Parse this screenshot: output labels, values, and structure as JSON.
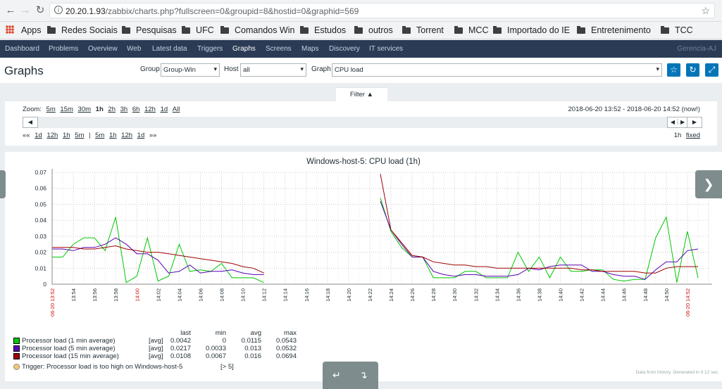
{
  "browser": {
    "url_host": "20.20.1.93",
    "url_path": "/zabbix/charts.php?fullscreen=0&groupid=8&hostid=0&graphid=569"
  },
  "bookmarks": [
    "Apps",
    "Redes Sociais",
    "Pesquisas",
    "UFC",
    "Comandos Win",
    "Estudos",
    "outros",
    "Torrent",
    "MCC",
    "Importado do IE",
    "Entretenimento",
    "TCC"
  ],
  "topnav": {
    "items": [
      "Dashboard",
      "Problems",
      "Overview",
      "Web",
      "Latest data",
      "Triggers",
      "Graphs",
      "Screens",
      "Maps",
      "Discovery",
      "IT services"
    ],
    "active": "Graphs",
    "right": "Gerencia-AJ"
  },
  "header": {
    "title": "Graphs",
    "group_label": "Group",
    "group_value": "Group-Win",
    "host_label": "Host",
    "host_value": "all",
    "graph_label": "Graph",
    "graph_value": "CPU load"
  },
  "filter": {
    "tab_label": "Filter ▲",
    "zoom_label": "Zoom:",
    "zoom_options": [
      "5m",
      "15m",
      "30m",
      "1h",
      "2h",
      "3h",
      "6h",
      "12h",
      "1d",
      "All"
    ],
    "zoom_current": "1h",
    "period": "2018-06-20 13:52 - 2018-06-20 14:52 (now!)",
    "nav_back": [
      "««",
      "1d",
      "12h",
      "1h",
      "5m",
      "|",
      "5m",
      "1h",
      "12h",
      "1d",
      "»»"
    ],
    "span": "1h",
    "fixed": "fixed"
  },
  "colors": {
    "series1": "#00c800",
    "series2": "#5a00b4",
    "series3": "#a00000",
    "trigger": "#f5c872"
  },
  "chart_data": {
    "type": "line",
    "title": "Windows-host-5: CPU load (1h)",
    "ylim": [
      0,
      0.07
    ],
    "yticks": [
      "0.07",
      "0.06",
      "0.05",
      "0.04",
      "0.03",
      "0.02",
      "0.01",
      "0"
    ],
    "xticks": [
      "06-20 13:52",
      "13:54",
      "13:56",
      "13:58",
      "14:00",
      "14:02",
      "14:04",
      "14:06",
      "14:08",
      "14:10",
      "14:12",
      "14:14",
      "14:16",
      "14:18",
      "14:20",
      "14:22",
      "14:24",
      "14:26",
      "14:28",
      "14:30",
      "14:32",
      "14:34",
      "14:36",
      "14:38",
      "14:40",
      "14:42",
      "14:44",
      "14:46",
      "14:48",
      "14:50",
      "06-20 14:52"
    ],
    "red_ticks": [
      "06-20 13:52",
      "14:00",
      "06-20 14:52"
    ],
    "series": [
      {
        "name": "Processor load (1 min average)",
        "func": "[avg]",
        "last": "0.0042",
        "min": "0",
        "avg": "0.0115",
        "max": "0.0543",
        "points": [
          [
            0,
            0.017
          ],
          [
            1,
            0.017
          ],
          [
            2,
            0.025
          ],
          [
            3,
            0.029
          ],
          [
            4,
            0.029
          ],
          [
            5,
            0.021
          ],
          [
            6,
            0.042
          ],
          [
            7,
            0.001
          ],
          [
            8,
            0.005
          ],
          [
            9,
            0.029
          ],
          [
            10,
            0.002
          ],
          [
            11,
            0.005
          ],
          [
            12,
            0.025
          ],
          [
            13,
            0.008
          ],
          [
            14,
            0.009
          ],
          [
            15,
            0.008
          ],
          [
            16,
            0.013
          ],
          [
            17,
            0.004
          ],
          [
            18,
            0.004
          ],
          [
            19,
            0.004
          ],
          [
            20,
            0.001
          ],
          [
            31,
            0.054
          ],
          [
            32,
            0.033
          ],
          [
            33,
            0.023
          ],
          [
            34,
            0.017
          ],
          [
            35,
            0.017
          ],
          [
            36,
            0.004
          ],
          [
            37,
            0.004
          ],
          [
            38,
            0.004
          ],
          [
            39,
            0.008
          ],
          [
            40,
            0.008
          ],
          [
            41,
            0.004
          ],
          [
            42,
            0.004
          ],
          [
            43,
            0.004
          ],
          [
            44,
            0.02
          ],
          [
            45,
            0.008
          ],
          [
            46,
            0.017
          ],
          [
            47,
            0.004
          ],
          [
            48,
            0.017
          ],
          [
            49,
            0.008
          ],
          [
            50,
            0.008
          ],
          [
            51,
            0.009
          ],
          [
            52,
            0.009
          ],
          [
            53,
            0.003
          ],
          [
            54,
            0.002
          ],
          [
            55,
            0.003
          ],
          [
            56,
            0.003
          ],
          [
            57,
            0.029
          ],
          [
            58,
            0.042
          ],
          [
            59,
            0.001
          ],
          [
            60,
            0.033
          ],
          [
            61,
            0.004
          ]
        ]
      },
      {
        "name": "Processor load (5 min average)",
        "func": "[avg]",
        "last": "0.0217",
        "min": "0.0033",
        "avg": "0.013",
        "max": "0.0532",
        "points": [
          [
            0,
            0.022
          ],
          [
            1,
            0.022
          ],
          [
            2,
            0.021
          ],
          [
            3,
            0.023
          ],
          [
            4,
            0.023
          ],
          [
            5,
            0.025
          ],
          [
            6,
            0.029
          ],
          [
            7,
            0.025
          ],
          [
            8,
            0.019
          ],
          [
            9,
            0.019
          ],
          [
            10,
            0.015
          ],
          [
            11,
            0.007
          ],
          [
            12,
            0.008
          ],
          [
            13,
            0.012
          ],
          [
            14,
            0.007
          ],
          [
            15,
            0.008
          ],
          [
            16,
            0.008
          ],
          [
            17,
            0.009
          ],
          [
            18,
            0.007
          ],
          [
            19,
            0.006
          ],
          [
            20,
            0.006
          ],
          [
            31,
            0.052
          ],
          [
            32,
            0.034
          ],
          [
            33,
            0.025
          ],
          [
            34,
            0.017
          ],
          [
            35,
            0.017
          ],
          [
            36,
            0.008
          ],
          [
            37,
            0.006
          ],
          [
            38,
            0.005
          ],
          [
            39,
            0.006
          ],
          [
            40,
            0.006
          ],
          [
            41,
            0.005
          ],
          [
            42,
            0.005
          ],
          [
            43,
            0.005
          ],
          [
            44,
            0.006
          ],
          [
            45,
            0.01
          ],
          [
            46,
            0.009
          ],
          [
            47,
            0.011
          ],
          [
            48,
            0.012
          ],
          [
            49,
            0.012
          ],
          [
            50,
            0.012
          ],
          [
            51,
            0.008
          ],
          [
            52,
            0.008
          ],
          [
            53,
            0.006
          ],
          [
            54,
            0.005
          ],
          [
            55,
            0.005
          ],
          [
            56,
            0.003
          ],
          [
            57,
            0.009
          ],
          [
            58,
            0.014
          ],
          [
            59,
            0.014
          ],
          [
            60,
            0.021
          ],
          [
            61,
            0.022
          ]
        ]
      },
      {
        "name": "Processor load (15 min average)",
        "func": "[avg]",
        "last": "0.0108",
        "min": "0.0067",
        "avg": "0.016",
        "max": "0.0694",
        "points": [
          [
            0,
            0.023
          ],
          [
            1,
            0.023
          ],
          [
            2,
            0.023
          ],
          [
            3,
            0.022
          ],
          [
            4,
            0.022
          ],
          [
            5,
            0.023
          ],
          [
            6,
            0.024
          ],
          [
            7,
            0.022
          ],
          [
            8,
            0.021
          ],
          [
            9,
            0.02
          ],
          [
            10,
            0.02
          ],
          [
            11,
            0.019
          ],
          [
            12,
            0.018
          ],
          [
            13,
            0.017
          ],
          [
            14,
            0.016
          ],
          [
            15,
            0.015
          ],
          [
            16,
            0.014
          ],
          [
            17,
            0.013
          ],
          [
            18,
            0.011
          ],
          [
            19,
            0.01
          ],
          [
            20,
            0.007
          ],
          [
            31,
            0.069
          ],
          [
            32,
            0.034
          ],
          [
            33,
            0.026
          ],
          [
            34,
            0.018
          ],
          [
            35,
            0.017
          ],
          [
            36,
            0.014
          ],
          [
            37,
            0.013
          ],
          [
            38,
            0.012
          ],
          [
            39,
            0.012
          ],
          [
            40,
            0.011
          ],
          [
            41,
            0.011
          ],
          [
            42,
            0.01
          ],
          [
            43,
            0.01
          ],
          [
            44,
            0.01
          ],
          [
            45,
            0.01
          ],
          [
            46,
            0.01
          ],
          [
            47,
            0.01
          ],
          [
            48,
            0.01
          ],
          [
            49,
            0.01
          ],
          [
            50,
            0.009
          ],
          [
            51,
            0.009
          ],
          [
            52,
            0.008
          ],
          [
            53,
            0.008
          ],
          [
            54,
            0.008
          ],
          [
            55,
            0.008
          ],
          [
            56,
            0.007
          ],
          [
            57,
            0.007
          ],
          [
            58,
            0.01
          ],
          [
            59,
            0.011
          ],
          [
            60,
            0.011
          ],
          [
            61,
            0.011
          ]
        ]
      }
    ],
    "trigger": {
      "name": "Trigger: Processor load is too high on Windows-host-5",
      "value": "[> 5]"
    },
    "legend_headers": [
      "last",
      "min",
      "avg",
      "max"
    ],
    "footer": "Data from history. Generated in 0.12 sec."
  }
}
